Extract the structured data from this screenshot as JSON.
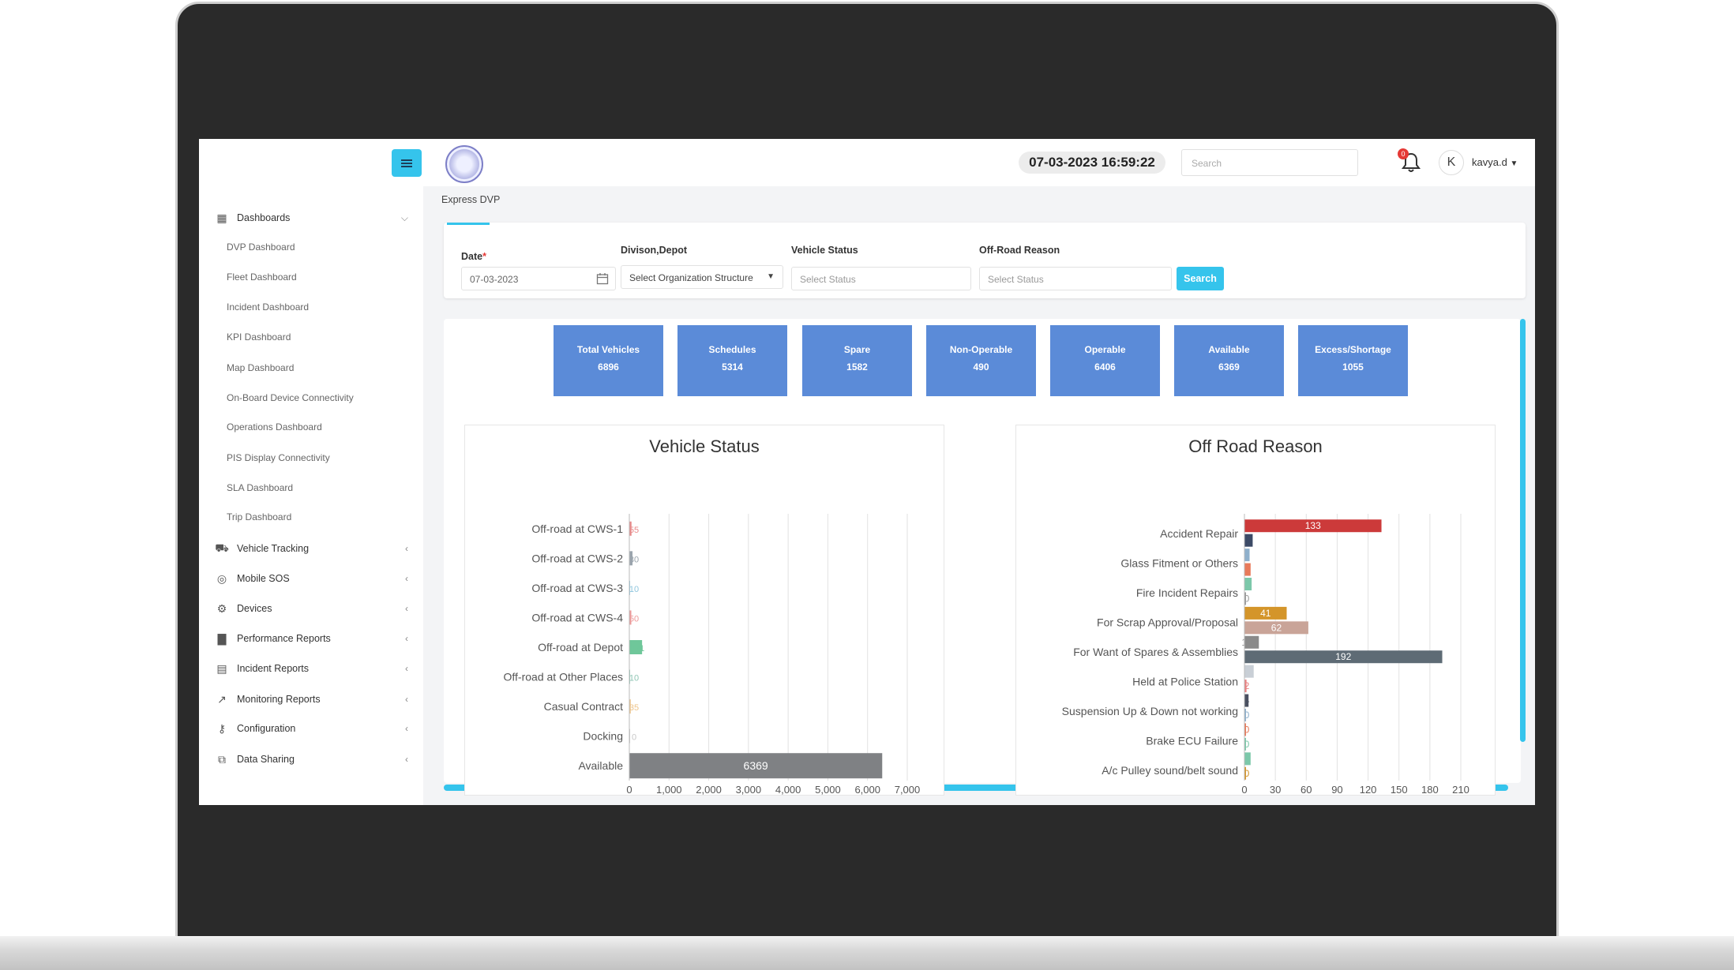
{
  "app": {
    "datetime": "07-03-2023 16:59:22",
    "search_placeholder": "Search",
    "notification_count": "0",
    "user_initial": "K",
    "username": "kavya.d"
  },
  "sidebar": {
    "sections": [
      {
        "label": "Dashboards",
        "icon": "dashboard-icon"
      },
      {
        "label": "Vehicle Tracking",
        "icon": "vehicle-tracking-icon"
      },
      {
        "label": "Mobile SOS",
        "icon": "sos-icon"
      },
      {
        "label": "Devices",
        "icon": "devices-icon"
      },
      {
        "label": "Performance Reports",
        "icon": "bar-chart-icon"
      },
      {
        "label": "Incident Reports",
        "icon": "clipboard-icon"
      },
      {
        "label": "Monitoring Reports",
        "icon": "monitoring-icon"
      },
      {
        "label": "Configuration",
        "icon": "key-icon"
      },
      {
        "label": "Data Sharing",
        "icon": "data-sharing-icon"
      }
    ],
    "dashboard_items": [
      "DVP Dashboard",
      "Fleet Dashboard",
      "Incident Dashboard",
      "KPI Dashboard",
      "Map Dashboard",
      "On-Board Device Connectivity",
      "Operations Dashboard",
      "PIS Display Connectivity",
      "SLA Dashboard",
      "Trip Dashboard"
    ]
  },
  "breadcrumb": "Express DVP",
  "filters": {
    "date_label": "Date",
    "date_required_mark": "*",
    "date_value": "07-03-2023",
    "division_label": "Divison,Depot",
    "division_value": "Select Organization Structure",
    "vehicle_status_label": "Vehicle Status",
    "vehicle_status_placeholder": "Select Status",
    "offroad_label": "Off-Road Reason",
    "offroad_placeholder": "Select Status",
    "search_button": "Search"
  },
  "kpis": [
    {
      "label": "Total Vehicles",
      "value": "6896"
    },
    {
      "label": "Schedules",
      "value": "5314"
    },
    {
      "label": "Spare",
      "value": "1582"
    },
    {
      "label": "Non-Operable",
      "value": "490"
    },
    {
      "label": "Operable",
      "value": "6406"
    },
    {
      "label": "Available",
      "value": "6369"
    },
    {
      "label": "Excess/Shortage",
      "value": "1055"
    }
  ],
  "colors": {
    "accent": "#35c4ec",
    "kpi_tile": "#5b8bd8"
  },
  "chart_data": [
    {
      "type": "bar",
      "orientation": "horizontal",
      "title": "Vehicle Status",
      "categories": [
        "Off-road at CWS-1",
        "Off-road at CWS-2",
        "Off-road at CWS-3",
        "Off-road at CWS-4",
        "Off-road at Depot",
        "Off-road at Other Places",
        "Casual Contract",
        "Docking",
        "Available"
      ],
      "values": [
        55,
        80,
        10,
        50,
        321,
        10,
        35,
        0,
        6369
      ],
      "data_labels": [
        "55",
        "80",
        "10",
        "50",
        "321",
        "10",
        "35",
        "0",
        "6369"
      ],
      "colors": [
        "#e88a8a",
        "#9aa4ad",
        "#8fc6de",
        "#ee9a9a",
        "#6fc79a",
        "#8fc6b4",
        "#eec48a",
        "#c8c8c8",
        "#7f8184"
      ],
      "xlim": [
        0,
        7000
      ],
      "x_ticks": [
        "0",
        "1,000",
        "2,000",
        "3,000",
        "4,000",
        "5,000",
        "6,000",
        "7,000"
      ],
      "grid": true
    },
    {
      "type": "bar",
      "orientation": "horizontal",
      "title": "Off Road Reason",
      "bars": [
        {
          "value": 133,
          "color": "#cc3a3a"
        },
        {
          "value": 8,
          "color": "#3c4a66"
        },
        {
          "value": 5,
          "color": "#8fb0cc"
        },
        {
          "value": 6,
          "color": "#e87a5a"
        },
        {
          "value": 7,
          "color": "#7cc8aa"
        },
        {
          "value": 0,
          "color": "#999999"
        },
        {
          "value": 41,
          "color": "#d4952a"
        },
        {
          "value": 62,
          "color": "#c9a498"
        },
        {
          "value": 14,
          "color": "#8a8a8a"
        },
        {
          "value": 192,
          "color": "#5e6b75"
        },
        {
          "value": 9,
          "color": "#c9cfd6"
        },
        {
          "value": 2,
          "color": "#e88080"
        },
        {
          "value": 4,
          "color": "#4a5060"
        },
        {
          "value": 0,
          "color": "#8fb0cc"
        },
        {
          "value": 0,
          "color": "#e87a5a"
        },
        {
          "value": 0,
          "color": "#7cc8aa"
        },
        {
          "value": 6,
          "color": "#7cc8aa"
        },
        {
          "value": 0,
          "color": "#d4952a"
        }
      ],
      "data_labels": [
        "133",
        "8",
        "5",
        "6",
        "7",
        "0",
        "41",
        "62",
        "14",
        "192",
        "9",
        "2",
        "4",
        "0",
        "0",
        "0",
        "6",
        "0"
      ],
      "category_labels": [
        "Accident Repair",
        "Glass Fitment or Others",
        "Fire Incident Repairs",
        "For Scrap Approval/Proposal",
        "For Want of Spares & Assemblies",
        "Held at Police Station",
        "Suspension Up & Down not working",
        "Brake ECU Failure",
        "A/c Pulley sound/belt sound"
      ],
      "xlim": [
        0,
        210
      ],
      "x_ticks": [
        "0",
        "30",
        "60",
        "90",
        "120",
        "150",
        "180",
        "210"
      ],
      "grid": true
    }
  ]
}
